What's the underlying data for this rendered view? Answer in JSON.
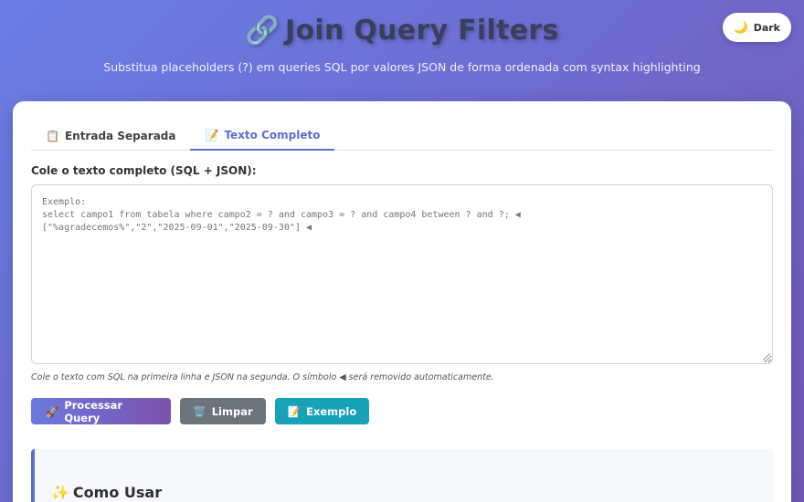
{
  "header": {
    "title_icon": "🔗",
    "title": "Join Query Filters",
    "subtitle": "Substitua placeholders (?) em queries SQL por valores JSON de forma ordenada com syntax highlighting"
  },
  "theme_toggle": {
    "icon": "🌙",
    "label": "Dark"
  },
  "tabs": [
    {
      "icon": "📋",
      "label": "Entrada Separada",
      "active": false
    },
    {
      "icon": "📝",
      "label": "Texto Completo",
      "active": true
    }
  ],
  "input": {
    "label": "Cole o texto completo (SQL + JSON):",
    "placeholder": "Exemplo:\nselect campo1 from tabela where campo2 = ? and campo3 = ? and campo4 between ? and ?; ◀\n[\"%agradecemos%\",\"2\",\"2025-09-01\",\"2025-09-30\"] ◀",
    "value": "",
    "hint": "Cole o texto com SQL na primeira linha e JSON na segunda. O símbolo ◀ será removido automaticamente."
  },
  "buttons": {
    "process": {
      "icon": "🚀",
      "label": "Processar Query"
    },
    "clear": {
      "icon": "🗑️",
      "label": "Limpar"
    },
    "example": {
      "icon": "📝",
      "label": "Exemplo"
    }
  },
  "howto": {
    "icon": "✨",
    "title": "Como Usar"
  },
  "colors": {
    "accent": "#5b6fd0",
    "gradient_start": "#6a7ee6",
    "gradient_end": "#7358b8",
    "clear_button": "#6c757d",
    "example_button": "#17a2b8"
  }
}
